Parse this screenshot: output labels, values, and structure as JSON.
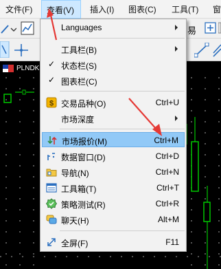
{
  "menubar": {
    "items": [
      {
        "label": "文件(F)"
      },
      {
        "label": "查看(V)"
      },
      {
        "label": "插入(I)"
      },
      {
        "label": "图表(C)"
      },
      {
        "label": "工具(T)"
      },
      {
        "label": "窗"
      }
    ]
  },
  "toolbar": {
    "partial_label": "易"
  },
  "chart": {
    "title": "PLNDK"
  },
  "view_menu": {
    "languages": "Languages",
    "toolbars": "工具栏(B)",
    "status_bar": "状态栏(S)",
    "chart_bar": "图表栏(C)",
    "symbols": {
      "label": "交易品种(O)",
      "shortcut": "Ctrl+U"
    },
    "depth": {
      "label": "市场深度"
    },
    "market_watch": {
      "label": "市场报价(M)",
      "shortcut": "Ctrl+M"
    },
    "data_window": {
      "label": "数据窗口(D)",
      "shortcut": "Ctrl+D"
    },
    "navigator": {
      "label": "导航(N)",
      "shortcut": "Ctrl+N"
    },
    "toolbox": {
      "label": "工具箱(T)",
      "shortcut": "Ctrl+T"
    },
    "strategy_tester": {
      "label": "策略测试(R)",
      "shortcut": "Ctrl+R"
    },
    "chat": {
      "label": "聊天(H)",
      "shortcut": "Alt+M"
    },
    "fullscreen": {
      "label": "全屏(F)",
      "shortcut": "F11"
    },
    "check_mark": "✓"
  },
  "colors": {
    "highlight": "#91c9f7",
    "annotation": "#e53935",
    "candle_green": "#00c800"
  }
}
